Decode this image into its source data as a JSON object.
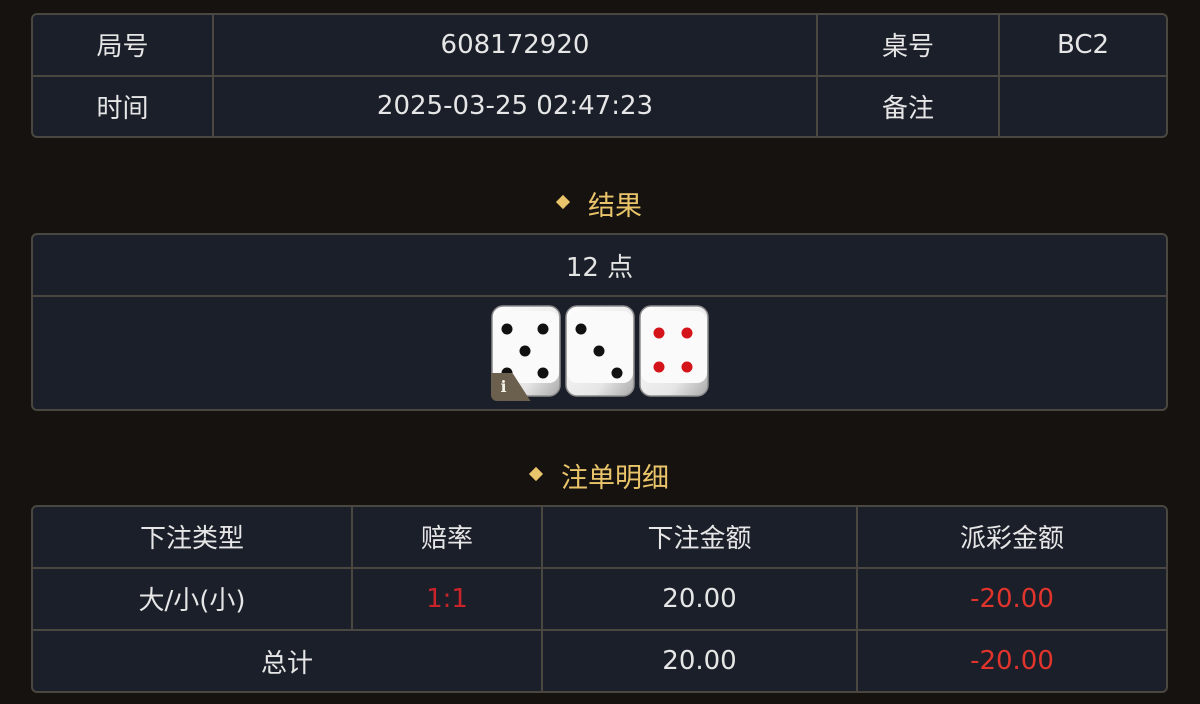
{
  "info": {
    "round_label": "局号",
    "round_value": "608172920",
    "table_label": "桌号",
    "table_value": "BC2",
    "time_label": "时间",
    "time_value": "2025-03-25 02:47:23",
    "remark_label": "备注",
    "remark_value": ""
  },
  "result": {
    "section_title": "结果",
    "points_text": "12 点",
    "dice": [
      5,
      3,
      4
    ],
    "info_badge": "i"
  },
  "bets": {
    "section_title": "注单明细",
    "headers": [
      "下注类型",
      "赔率",
      "下注金额",
      "派彩金额"
    ],
    "rows": [
      {
        "type": "大/小(小)",
        "odds": "1:1",
        "bet_amount": "20.00",
        "payout": "-20.00"
      }
    ],
    "total": {
      "label": "总计",
      "bet_amount": "20.00",
      "payout": "-20.00"
    }
  },
  "colors": {
    "background": "#16120f",
    "panel": "#1b1f2a",
    "border": "#4a4740",
    "accent_gold": "#e9c46a",
    "negative_red": "#e0342c"
  }
}
